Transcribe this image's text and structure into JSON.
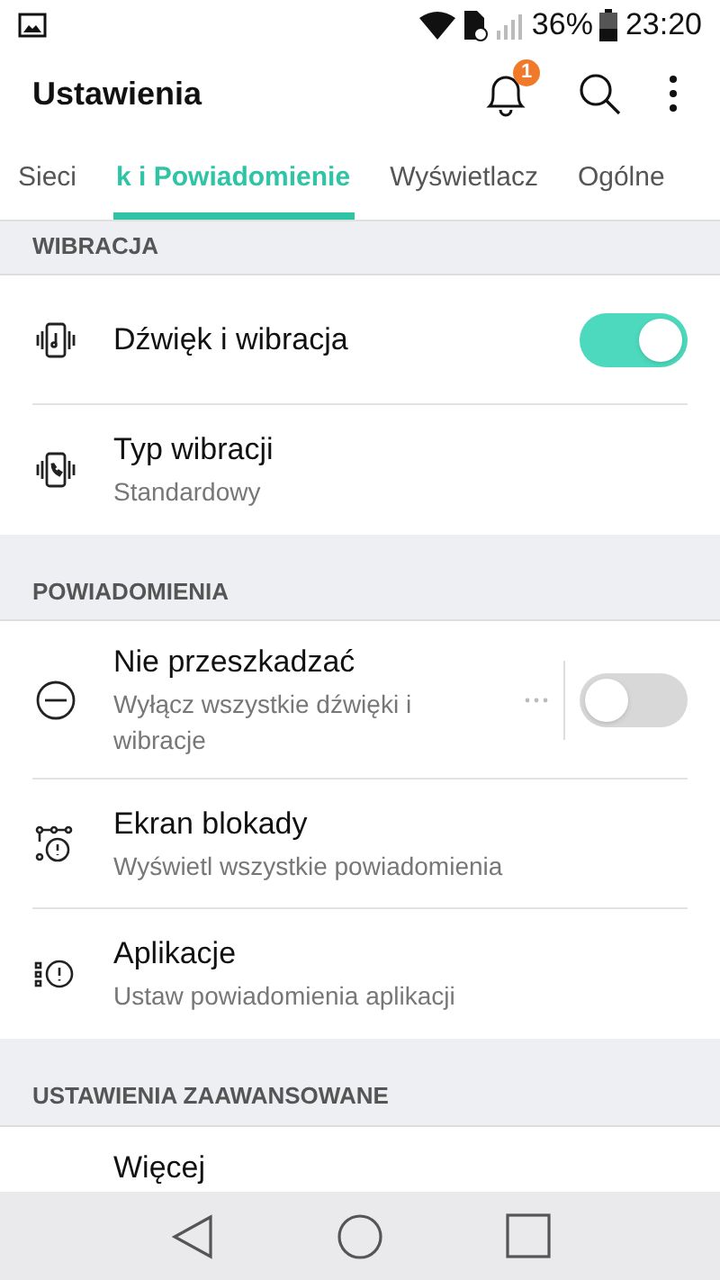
{
  "status_bar": {
    "battery": "36%",
    "time": "23:20"
  },
  "app_bar": {
    "title": "Ustawienia",
    "notification_count": "1"
  },
  "tabs": [
    {
      "label": "Sieci",
      "selected": false
    },
    {
      "label": "k i Powiadomienie",
      "selected": true
    },
    {
      "label": "Wyświetlacz",
      "selected": false
    },
    {
      "label": "Ogólne",
      "selected": false
    }
  ],
  "sections": [
    {
      "header": "WIBRACJA",
      "items": [
        {
          "kind": "switch",
          "title": "Dźwięk i wibracja",
          "on": true
        },
        {
          "kind": "plain",
          "title": "Typ wibracji",
          "subtitle": "Standardowy"
        }
      ]
    },
    {
      "header": "POWIADOMIENIA",
      "items": [
        {
          "kind": "switch",
          "title": "Nie przeszkadzać",
          "subtitle": "Wyłącz wszystkie dźwięki i wibracje",
          "more": true,
          "on": false
        },
        {
          "kind": "plain",
          "title": "Ekran blokady",
          "subtitle": "Wyświetl wszystkie powiadomienia"
        },
        {
          "kind": "plain",
          "title": "Aplikacje",
          "subtitle": "Ustaw powiadomienia aplikacji"
        }
      ]
    },
    {
      "header": "USTAWIENIA ZAAWANSOWANE",
      "items": [
        {
          "kind": "plain",
          "title": "Więcej"
        }
      ]
    }
  ]
}
